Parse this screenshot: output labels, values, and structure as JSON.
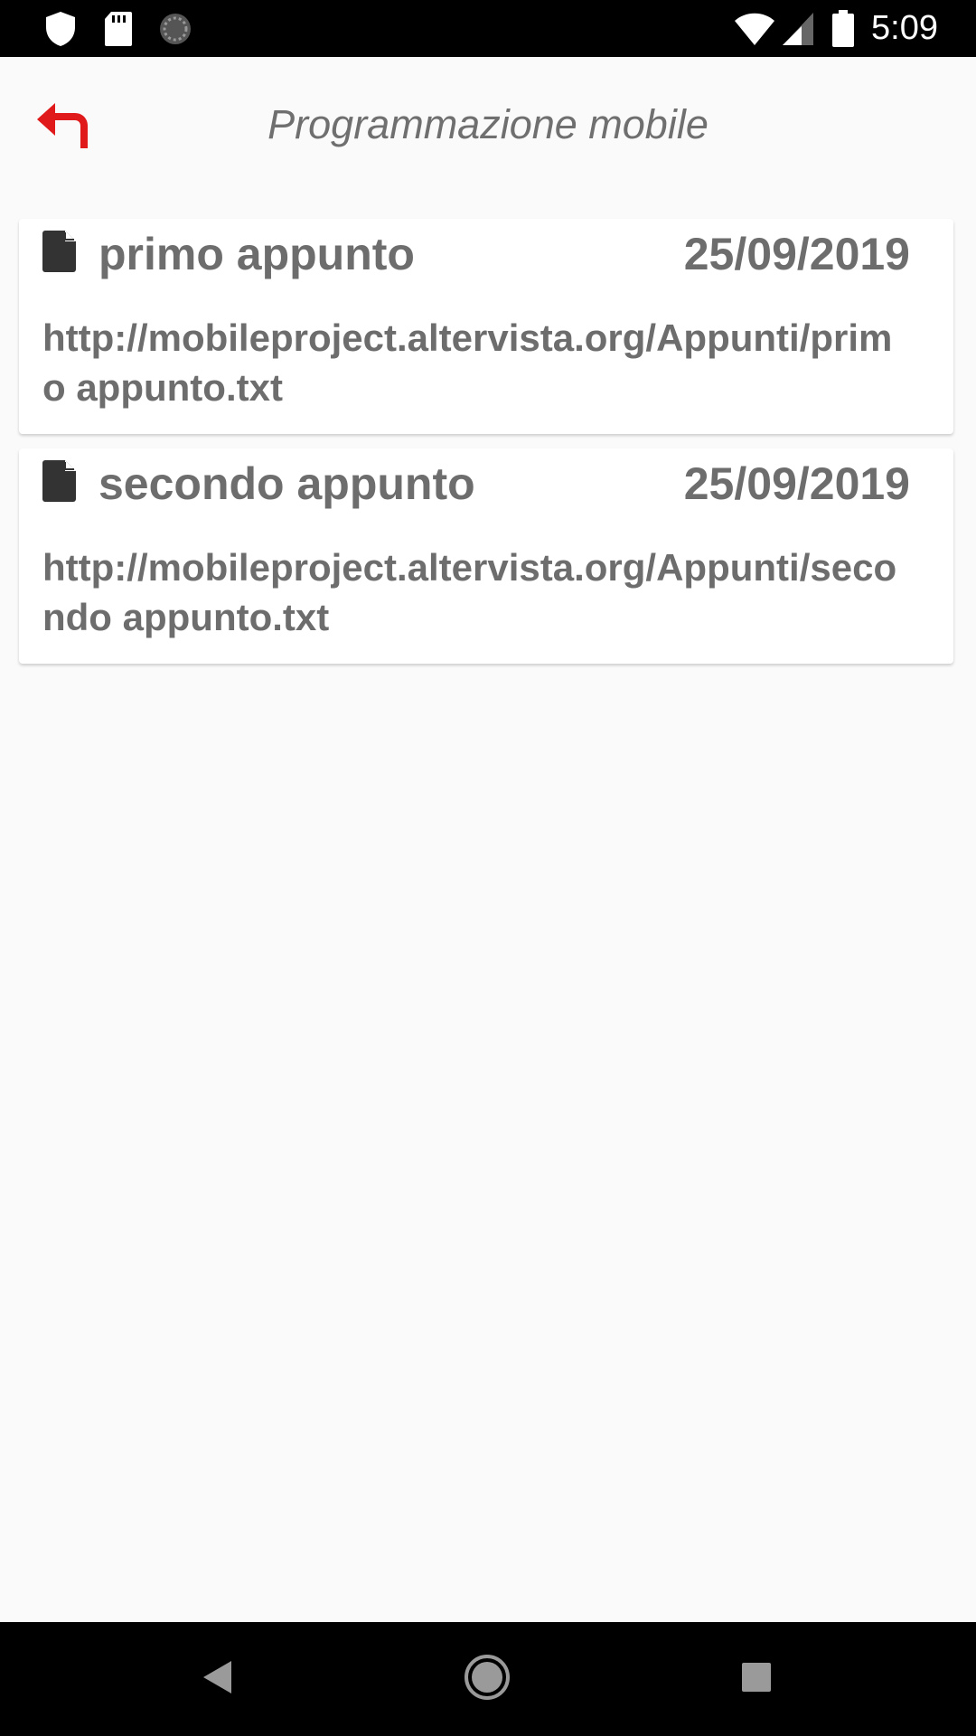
{
  "status_bar": {
    "time": "5:09",
    "icons": [
      "shield-icon",
      "sd-card-icon",
      "sync-icon",
      "wifi-icon",
      "signal-icon",
      "battery-icon"
    ]
  },
  "header": {
    "title": "Programmazione mobile",
    "back_icon": "back-arrow-icon",
    "accent_color": "#e0191a"
  },
  "notes": [
    {
      "title": "primo appunto",
      "date": "25/09/2019",
      "url": "http://mobileproject.altervista.org/Appunti/primo appunto.txt",
      "icon": "file-icon"
    },
    {
      "title": "secondo appunto",
      "date": "25/09/2019",
      "url": "http://mobileproject.altervista.org/Appunti/secondo appunto.txt",
      "icon": "file-icon"
    }
  ],
  "nav_bar": {
    "icons": [
      "back-triangle-icon",
      "home-circle-icon",
      "recents-square-icon"
    ]
  }
}
